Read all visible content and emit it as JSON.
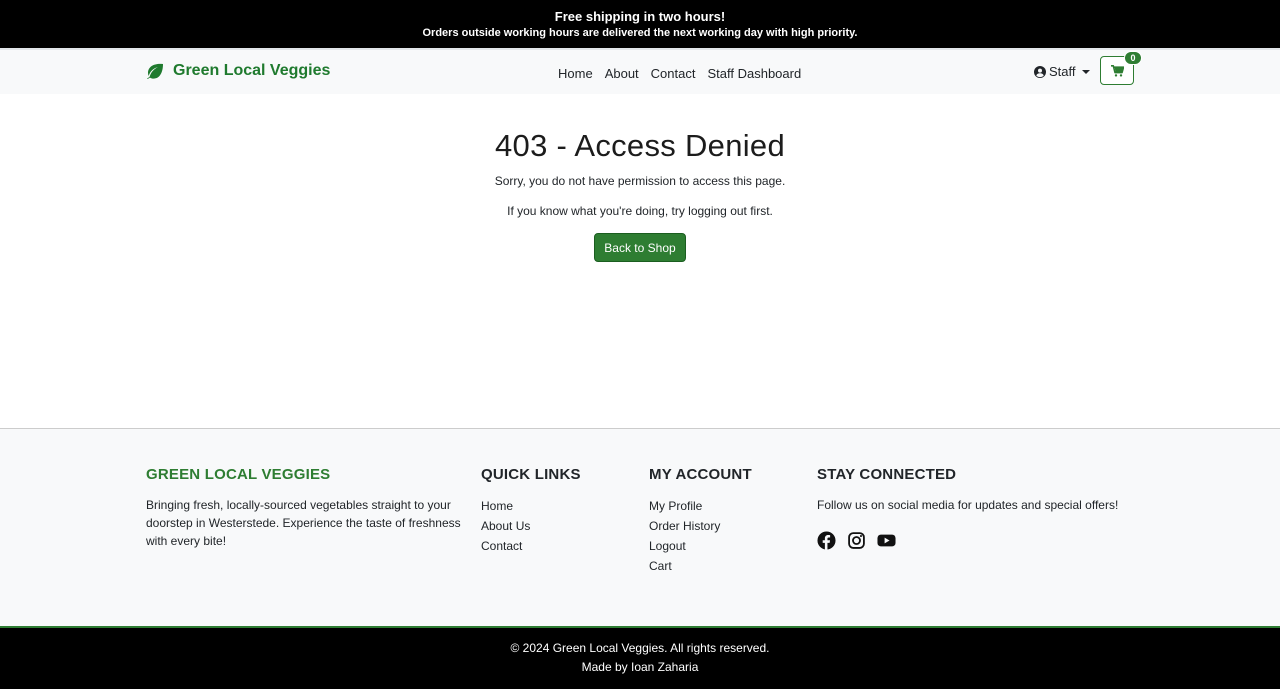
{
  "announcement": {
    "title": "Free shipping in two hours!",
    "subtitle": "Orders outside working hours are delivered the next working day with high priority."
  },
  "navbar": {
    "brand": "Green Local Veggies",
    "brand_icon": "leaf-icon",
    "links": [
      "Home",
      "About",
      "Contact",
      "Staff Dashboard"
    ],
    "user_menu_label": "Staff",
    "user_icon": "user-circle-icon",
    "cart_icon": "shopping-cart-icon",
    "cart_count": "0"
  },
  "main": {
    "heading": "403 - Access Denied",
    "message": "Sorry, you do not have permission to access this page.",
    "hint": "If you know what you're doing, try logging out first.",
    "button_label": "Back to Shop"
  },
  "footer": {
    "about": {
      "heading": "GREEN LOCAL VEGGIES",
      "text": "Bringing fresh, locally-sourced vegetables straight to your doorstep in Westerstede. Experience the taste of freshness with every bite!"
    },
    "quick_links": {
      "heading": "QUICK LINKS",
      "items": [
        "Home",
        "About Us",
        "Contact"
      ]
    },
    "my_account": {
      "heading": "MY ACCOUNT",
      "items": [
        "My Profile",
        "Order History",
        "Logout",
        "Cart"
      ]
    },
    "stay_connected": {
      "heading": "STAY CONNECTED",
      "text": "Follow us on social media for updates and special offers!",
      "icons": [
        "facebook-icon",
        "instagram-icon",
        "youtube-icon"
      ]
    }
  },
  "bottom": {
    "copyright": "© 2024 Green Local Veggies. All rights reserved.",
    "credit": "Made by Ioan Zaharia"
  },
  "colors": {
    "brand_green": "#2e7d32",
    "announcement_bg": "#000000",
    "navbar_bg": "#f8f9fa"
  }
}
